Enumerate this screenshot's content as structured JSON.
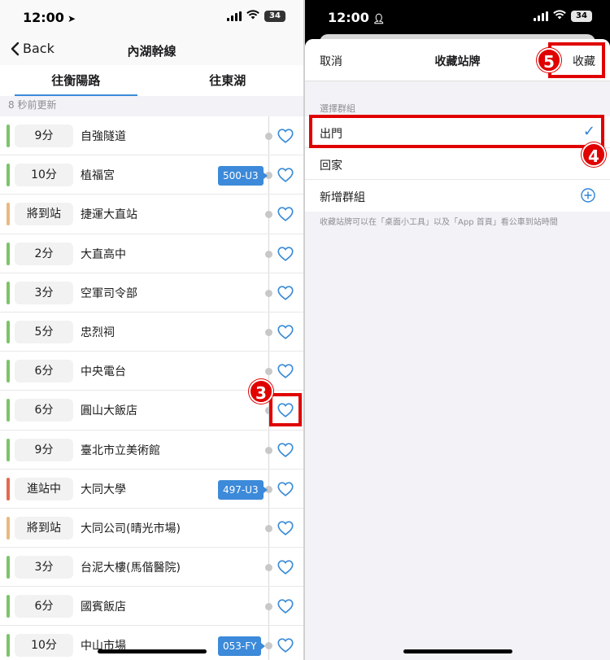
{
  "left": {
    "status": {
      "time": "12:00",
      "battery": "34"
    },
    "nav": {
      "back_label": "Back",
      "title": "內湖幹線"
    },
    "tabs": [
      {
        "label": "往衡陽路",
        "active": true
      },
      {
        "label": "往東湖",
        "active": false
      }
    ],
    "updated": "8 秒前更新",
    "stops": [
      {
        "eta": "9分",
        "name": "自強隧道",
        "status_color": "#7cc46a",
        "plate": ""
      },
      {
        "eta": "10分",
        "name": "植福宮",
        "status_color": "#7cc46a",
        "plate": "500-U3"
      },
      {
        "eta": "將到站",
        "name": "捷運大直站",
        "status_color": "#e8b980",
        "plate": ""
      },
      {
        "eta": "2分",
        "name": "大直高中",
        "status_color": "#7cc46a",
        "plate": ""
      },
      {
        "eta": "3分",
        "name": "空軍司令部",
        "status_color": "#7cc46a",
        "plate": ""
      },
      {
        "eta": "5分",
        "name": "忠烈祠",
        "status_color": "#7cc46a",
        "plate": ""
      },
      {
        "eta": "6分",
        "name": "中央電台",
        "status_color": "#7cc46a",
        "plate": ""
      },
      {
        "eta": "6分",
        "name": "圓山大飯店",
        "status_color": "#7cc46a",
        "plate": ""
      },
      {
        "eta": "9分",
        "name": "臺北市立美術館",
        "status_color": "#7cc46a",
        "plate": ""
      },
      {
        "eta": "進站中",
        "name": "大同大學",
        "status_color": "#e26a4f",
        "plate": "497-U3"
      },
      {
        "eta": "將到站",
        "name": "大同公司(晴光市場)",
        "status_color": "#e8b980",
        "plate": ""
      },
      {
        "eta": "3分",
        "name": "台泥大樓(馬偕醫院)",
        "status_color": "#7cc46a",
        "plate": ""
      },
      {
        "eta": "6分",
        "name": "國賓飯店",
        "status_color": "#7cc46a",
        "plate": ""
      },
      {
        "eta": "10分",
        "name": "中山市場",
        "status_color": "#7cc46a",
        "plate": "053-FY"
      }
    ]
  },
  "right": {
    "status": {
      "time": "12:00",
      "battery": "34"
    },
    "sheet": {
      "cancel_label": "取消",
      "title": "收藏站牌",
      "save_label": "收藏",
      "section_label": "選擇群組",
      "groups": [
        {
          "label": "出門",
          "selected": true
        },
        {
          "label": "回家",
          "selected": false
        }
      ],
      "add_group_label": "新增群組",
      "footnote": "收藏站牌可以在「桌面小工具」以及「App 首頁」看公車到站時間"
    }
  },
  "annotations": {
    "step3": "3",
    "step4": "4",
    "step5": "5"
  },
  "colors": {
    "accent": "#3a8bd8",
    "highlight": "#e00000"
  }
}
